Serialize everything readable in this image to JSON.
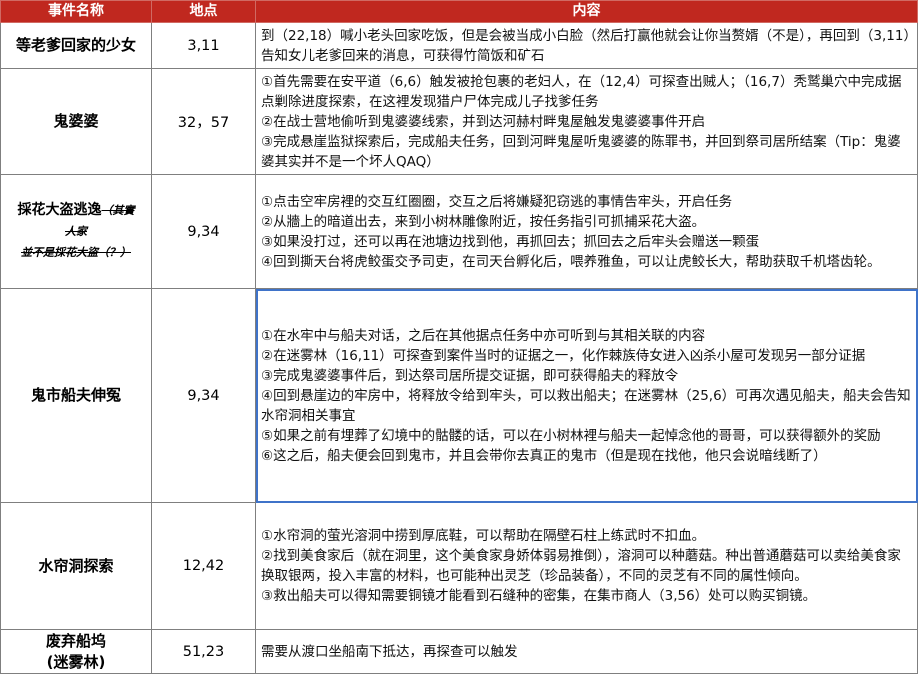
{
  "headers": {
    "name": "事件名称",
    "location": "地点",
    "content": "内容"
  },
  "rows": [
    {
      "name": "等老爹回家的少女",
      "location": "3,11",
      "content": [
        "到（22,18）喊小老头回家吃饭，但是会被当成小白脸（然后打赢他就会让你当赘婿（不是），再回到（3,11）告知女儿老爹回来的消息，可获得竹简饭和矿石"
      ]
    },
    {
      "name": "鬼婆婆",
      "location": "32，57",
      "content": [
        "①首先需要在安平道（6,6）触发被抢包裹的老妇人，在（12,4）可探查出贼人；（16,7）秃鹫巢穴中完成据点剿除进度探索，在这裡发现猎户尸体完成儿子找爹任务",
        "②在战士营地偷听到鬼婆婆线索，并到达河赫村畔鬼屋触发鬼婆婆事件开启",
        "③完成悬崖监狱探索后，完成船夫任务，回到河畔鬼屋听鬼婆婆的陈罪书，并回到祭司居所结案（Tip：鬼婆婆其实并不是一个坏人QAQ）"
      ]
    },
    {
      "name_main": "採花大盗逃逸",
      "name_strike1": "（其實",
      "name_strike2": "人家",
      "name_strike3": "並不是採花大盜（？）",
      "location": "9,34",
      "content": [
        "①点击空牢房裡的交互红圈圈，交互之后将嫌疑犯窃逃的事情告牢头，开启任务",
        "②从牆上的暗道出去，来到小树林雕像附近，按任务指引可抓捕采花大盗。",
        "③如果没打过，还可以再在池塘边找到他，再抓回去；抓回去之后牢头会赠送一颗蛋",
        "④回到撕天台将虎鲛蛋交予司吏，在司天台孵化后，喂养雅鱼，可以让虎鲛长大，帮助获取千机塔齿轮。"
      ]
    },
    {
      "name": "鬼市船夫伸冤",
      "location": "9,34",
      "content": [
        "①在水牢中与船夫对话，之后在其他据点任务中亦可听到与其相关联的内容",
        "②在迷雾林（16,11）可探查到案件当时的证据之一，化作棘族侍女进入凶杀小屋可发现另一部分证据",
        "③完成鬼婆婆事件后，到达祭司居所提交证据，即可获得船夫的释放令",
        "④回到悬崖边的牢房中，将释放令给到牢头，可以救出船夫；在迷雾林（25,6）可再次遇见船夫，船夫会告知水帘洞相关事宜",
        "⑤如果之前有埋葬了幻境中的骷髅的话，可以在小树林裡与船夫一起悼念他的哥哥，可以获得额外的奖励",
        "⑥这之后，船夫便会回到鬼市，并且会带你去真正的鬼市（但是现在找他，他只会说暗线断了）"
      ]
    },
    {
      "name": "水帘洞探索",
      "location": "12,42",
      "content": [
        "①水帘洞的萤光溶洞中捞到厚底鞋，可以帮助在隔壁石柱上练武时不扣血。",
        "②找到美食家后（就在洞里，这个美食家身娇体弱易推倒），溶洞可以种蘑菇。种出普通蘑菇可以卖给美食家换取银两，投入丰富的材料，也可能种出灵芝（珍品装备），不同的灵芝有不同的属性倾向。",
        "③救出船夫可以得知需要铜镜才能看到石缝种的密集，在集市商人（3,56）处可以购买铜镜。"
      ]
    },
    {
      "name_line1": "废弃船坞",
      "name_line2": "(迷雾林)",
      "location": "51,23",
      "content": [
        "需要从渡口坐船南下抵达，再探查可以触发"
      ]
    }
  ]
}
